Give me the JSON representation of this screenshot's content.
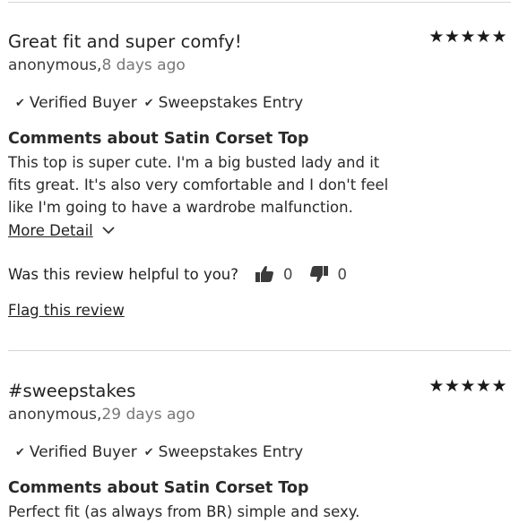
{
  "reviews": [
    {
      "title": "Great fit and super comfy!",
      "stars": "★★★★★",
      "rating": 5,
      "author": "anonymous,",
      "ago": "8 days ago",
      "badges": [
        "Verified Buyer",
        "Sweepstakes Entry"
      ],
      "heading": "Comments about Satin Corset Top",
      "body": "This top is super cute. I'm a big busted lady and it fits great. It's also very comfortable and I don't feel like I'm going to have a wardrobe malfunction.",
      "more_label": "More Detail",
      "helpful_label": "Was this review helpful to you?",
      "up_count": "0",
      "down_count": "0",
      "flag_label": "Flag this review"
    },
    {
      "title": "#sweepstakes",
      "stars": "★★★★★",
      "rating": 5,
      "author": "anonymous,",
      "ago": "29 days ago",
      "badges": [
        "Verified Buyer",
        "Sweepstakes Entry"
      ],
      "heading": "Comments about Satin Corset Top",
      "body": "Perfect fit (as always from BR) simple and sexy."
    }
  ]
}
